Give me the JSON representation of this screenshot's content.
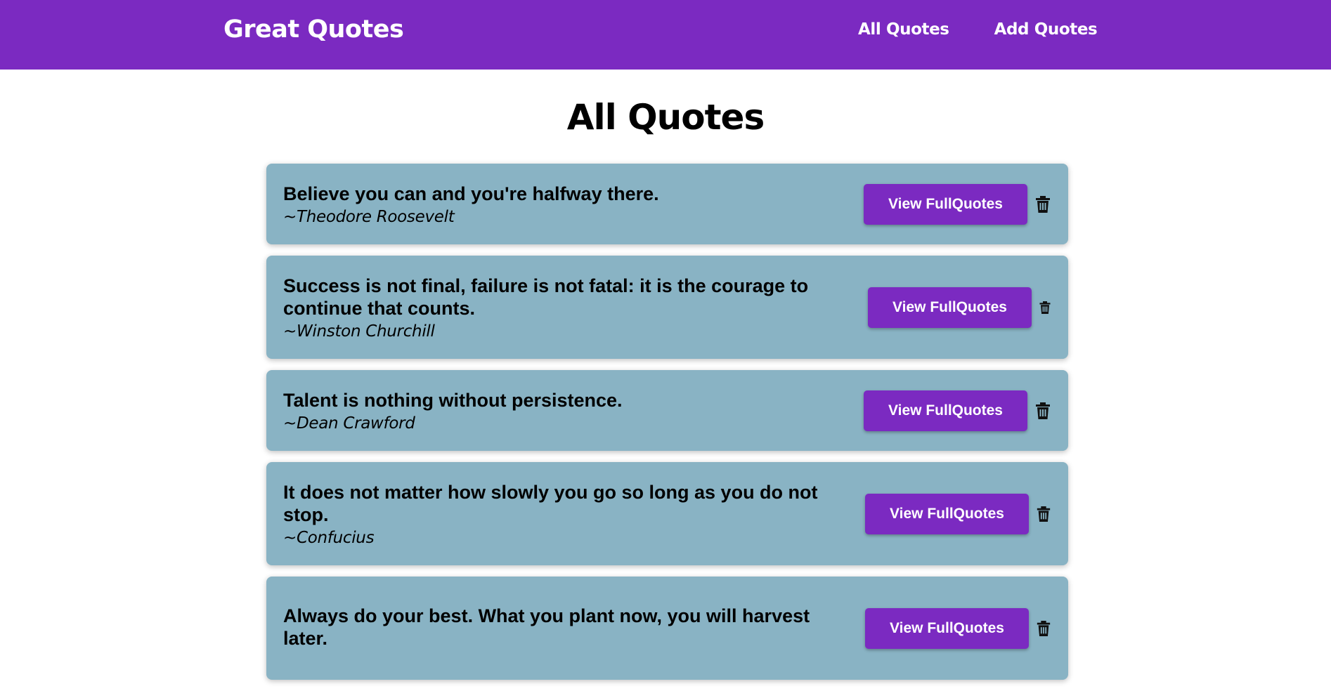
{
  "header": {
    "logo": "Great Quotes",
    "nav": {
      "all_quotes": "All Quotes",
      "add_quotes": "Add Quotes"
    }
  },
  "page_title": "All Quotes",
  "quotes": [
    {
      "text": "Believe you can and you're halfway there.",
      "author": "~Theodore Roosevelt",
      "button": "View FullQuotes"
    },
    {
      "text": "Success is not final, failure is not fatal: it is the courage to continue that counts.",
      "author": "~Winston Churchill",
      "button": "View FullQuotes"
    },
    {
      "text": "Talent is nothing without persistence.",
      "author": "~Dean Crawford",
      "button": "View FullQuotes"
    },
    {
      "text": "It does not matter how slowly you go so long as you do not stop.",
      "author": "~Confucius",
      "button": "View FullQuotes"
    },
    {
      "text": "Always do your best. What you plant now, you will harvest later.",
      "author": "",
      "button": "View FullQuotes"
    }
  ],
  "icons": {
    "delete": "trash-icon"
  },
  "colors": {
    "brand": "#7b2ac1",
    "card": "#89b3c4"
  }
}
